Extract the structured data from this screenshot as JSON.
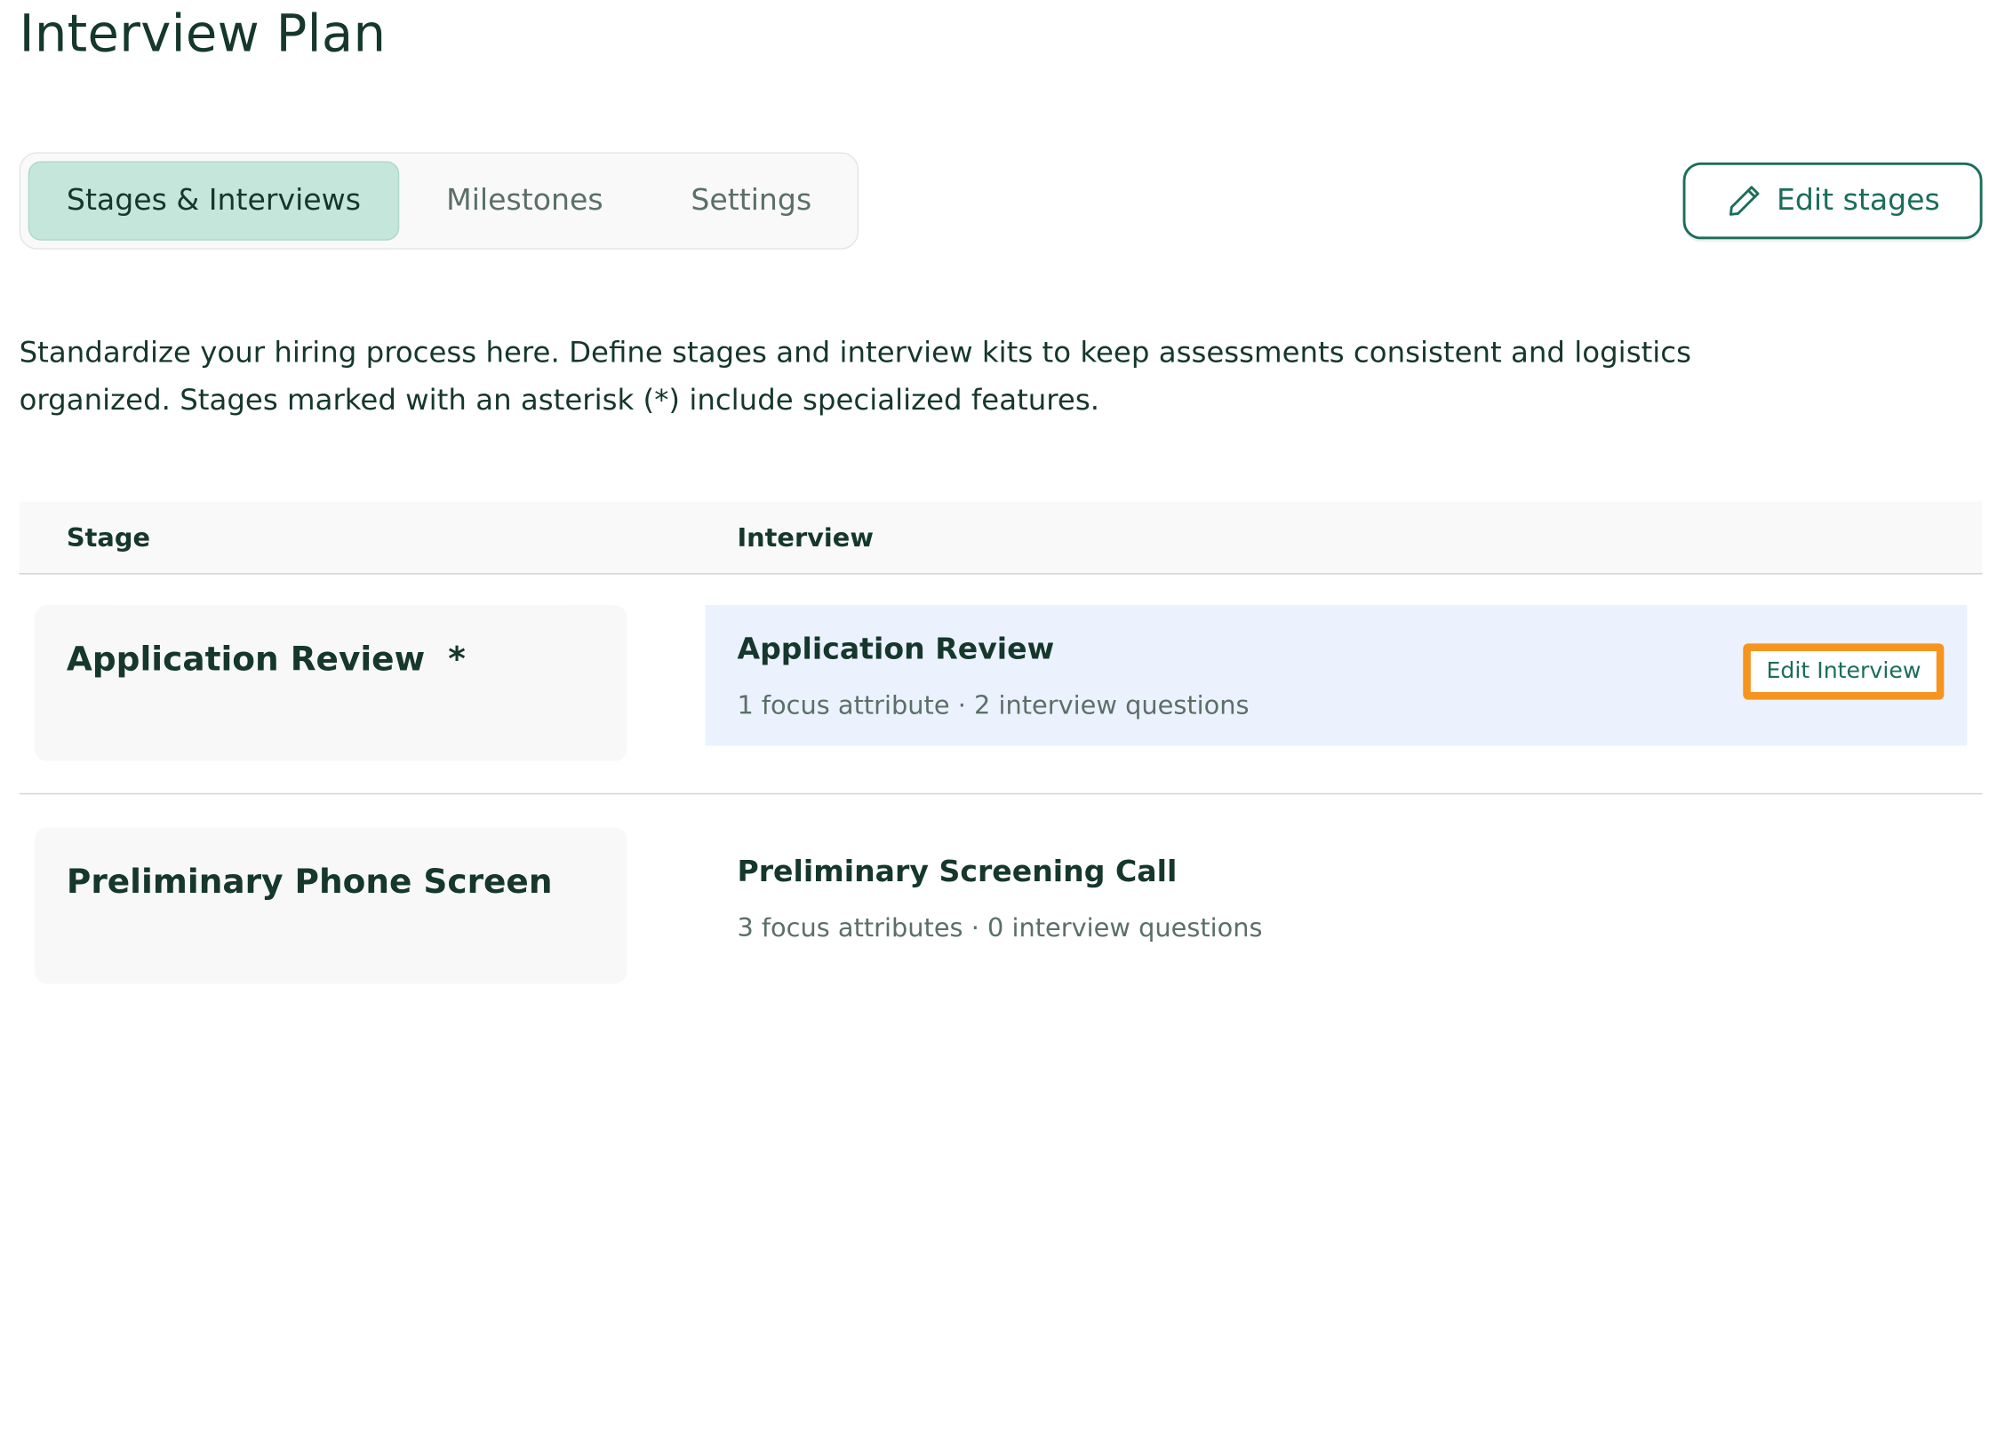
{
  "page": {
    "title": "Interview Plan",
    "description": "Standardize your hiring process here. Define stages and interview kits to keep assessments consistent and logistics organized. Stages marked with an asterisk (*) include specialized features."
  },
  "tabs": [
    {
      "label": "Stages & Interviews",
      "active": true
    },
    {
      "label": "Milestones",
      "active": false
    },
    {
      "label": "Settings",
      "active": false
    }
  ],
  "toolbar": {
    "edit_stages_label": "Edit stages",
    "edit_stages_icon": "pencil-icon"
  },
  "table": {
    "headers": {
      "stage": "Stage",
      "interview": "Interview"
    },
    "rows": [
      {
        "stage": "Application Review  *",
        "interview_name": "Application Review",
        "interview_meta": "1 focus attribute · 2 interview questions",
        "edit_label": "Edit Interview",
        "highlighted": true
      },
      {
        "stage": "Preliminary Phone Screen",
        "interview_name": "Preliminary Screening Call",
        "interview_meta": "3 focus attributes · 0 interview questions",
        "highlighted": false
      }
    ]
  },
  "colors": {
    "primary_text": "#15372c",
    "accent_green": "#1a6e57",
    "active_tab_bg": "#c4e6db",
    "highlight_row_bg": "#ebf2fd",
    "focus_outline": "#f7941d"
  }
}
